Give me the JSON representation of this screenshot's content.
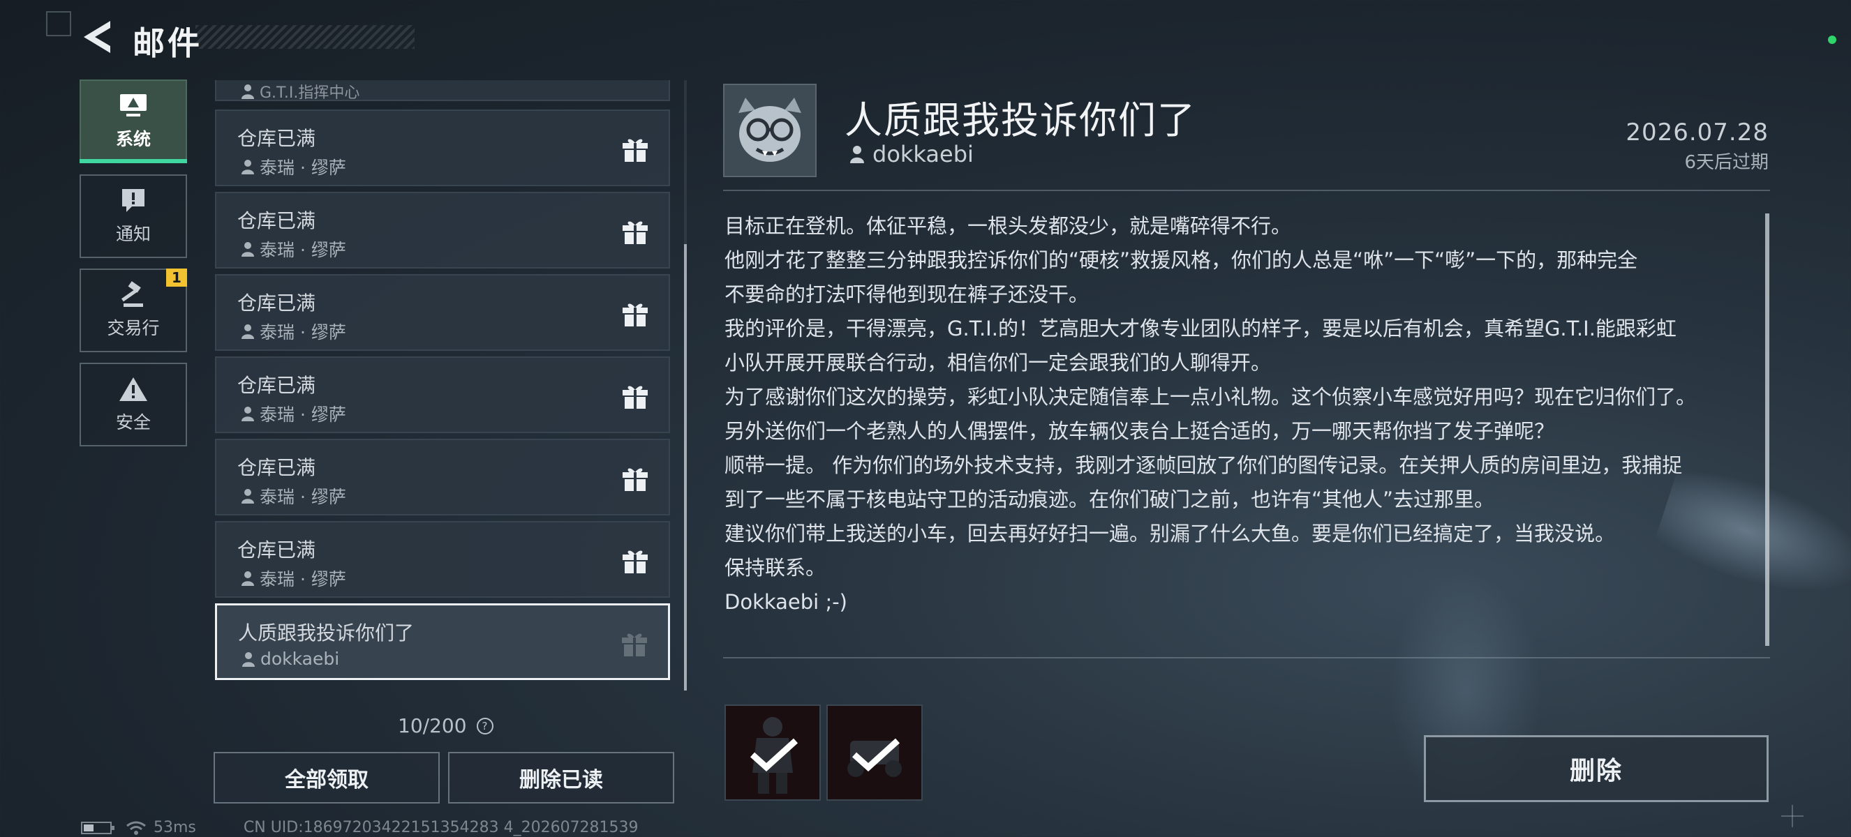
{
  "header": {
    "title": "邮件"
  },
  "tabs": [
    {
      "label": "系统",
      "icon": "monitor-icon",
      "active": true
    },
    {
      "label": "通知",
      "icon": "alert-icon",
      "active": false
    },
    {
      "label": "交易行",
      "icon": "gavel-icon",
      "active": false,
      "badge": "1"
    },
    {
      "label": "安全",
      "icon": "warning-icon",
      "active": false
    }
  ],
  "mail_list": {
    "partial_top": {
      "sender": "G.T.I.指挥中心"
    },
    "items": [
      {
        "subject": "仓库已满",
        "sender": "泰瑞 · 缪萨",
        "icon": "gift-icon"
      },
      {
        "subject": "仓库已满",
        "sender": "泰瑞 · 缪萨",
        "icon": "gift-icon"
      },
      {
        "subject": "仓库已满",
        "sender": "泰瑞 · 缪萨",
        "icon": "gift-icon"
      },
      {
        "subject": "仓库已满",
        "sender": "泰瑞 · 缪萨",
        "icon": "gift-icon"
      },
      {
        "subject": "仓库已满",
        "sender": "泰瑞 · 缪萨",
        "icon": "gift-icon"
      },
      {
        "subject": "仓库已满",
        "sender": "泰瑞 · 缪萨",
        "icon": "gift-icon"
      },
      {
        "subject": "人质跟我投诉你们了",
        "sender": "dokkaebi",
        "icon": "gift-icon",
        "selected": true
      }
    ],
    "count": "10/200",
    "claim_all_label": "全部领取",
    "delete_read_label": "删除已读"
  },
  "status_bar": {
    "ping": "53ms",
    "uid": "CN UID:18697203422151354283 4_202607281539"
  },
  "detail": {
    "title": "人质跟我投诉你们了",
    "sender": "dokkaebi",
    "date": "2026.07.28",
    "expire": "6天后过期",
    "body": [
      "目标正在登机。体征平稳，一根头发都没少，就是嘴碎得不行。",
      "他刚才花了整整三分钟跟我控诉你们的“硬核”救援风格，你们的人总是“咻”一下“嘭”一下的，那种完全",
      "不要命的打法吓得他到现在裤子还没干。",
      "我的评价是，干得漂亮，G.T.I.的！艺高胆大才像专业团队的样子，要是以后有机会，真希望G.T.I.能跟彩虹",
      "小队开展开展联合行动，相信你们一定会跟我们的人聊得开。",
      "为了感谢你们这次的操劳，彩虹小队决定随信奉上一点小礼物。这个侦察小车感觉好用吗？现在它归你们了。",
      "另外送你们一个老熟人的人偶摆件，放车辆仪表台上挺合适的，万一哪天帮你挡了发子弹呢？",
      "顺带一提。 作为你们的场外技术支持，我刚才逐帧回放了你们的图传记录。在关押人质的房间里边，我捕捉",
      "到了一些不属于核电站守卫的活动痕迹。在你们破门之前，也许有“其他人”去过那里。",
      "建议你们带上我送的小车，回去再好好扫一遍。别漏了什么大鱼。要是你们已经搞定了，当我没说。",
      "保持联系。",
      "Dokkaebi ;-)"
    ],
    "attachments": [
      {
        "name": "figure-attachment",
        "claimed": true
      },
      {
        "name": "drone-attachment",
        "claimed": true
      }
    ],
    "delete_label": "删除"
  },
  "colors": {
    "accent": "#3fd6a0",
    "badge": "#f2c230",
    "online": "#2fd46a"
  }
}
